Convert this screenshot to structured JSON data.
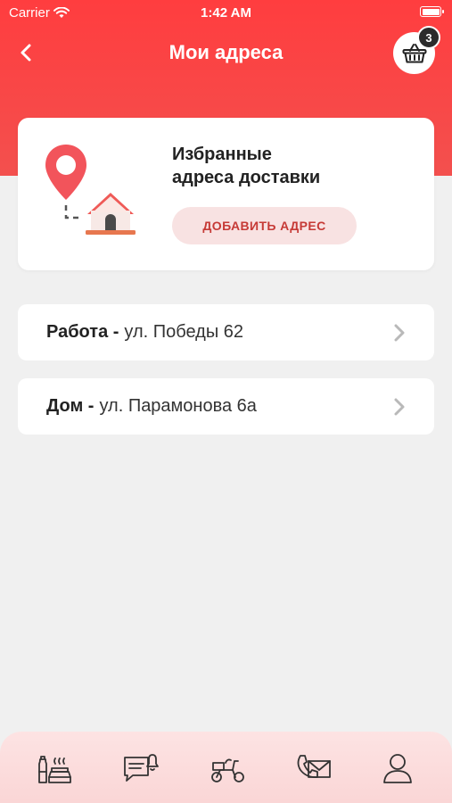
{
  "status": {
    "carrier": "Carrier",
    "time": "1:42 AM"
  },
  "header": {
    "title": "Мои адреса",
    "cart_count": "3"
  },
  "favorites": {
    "title_line1": "Избранные",
    "title_line2": "адреса доставки",
    "add_button": "ДОБАВИТЬ АДРЕС"
  },
  "addresses": [
    {
      "name": "Работа -",
      "street": "ул. Победы 62"
    },
    {
      "name": "Дом -",
      "street": "ул. Парамонова 6а"
    }
  ],
  "tabs": [
    {
      "icon": "menu-food-icon"
    },
    {
      "icon": "chat-notification-icon"
    },
    {
      "icon": "delivery-scooter-icon"
    },
    {
      "icon": "phone-mail-icon"
    },
    {
      "icon": "profile-icon"
    }
  ],
  "colors": {
    "primary": "#f3464a",
    "button_bg": "#f8e2e2",
    "button_text": "#c63a36",
    "tab_bar": "#fbdada"
  }
}
